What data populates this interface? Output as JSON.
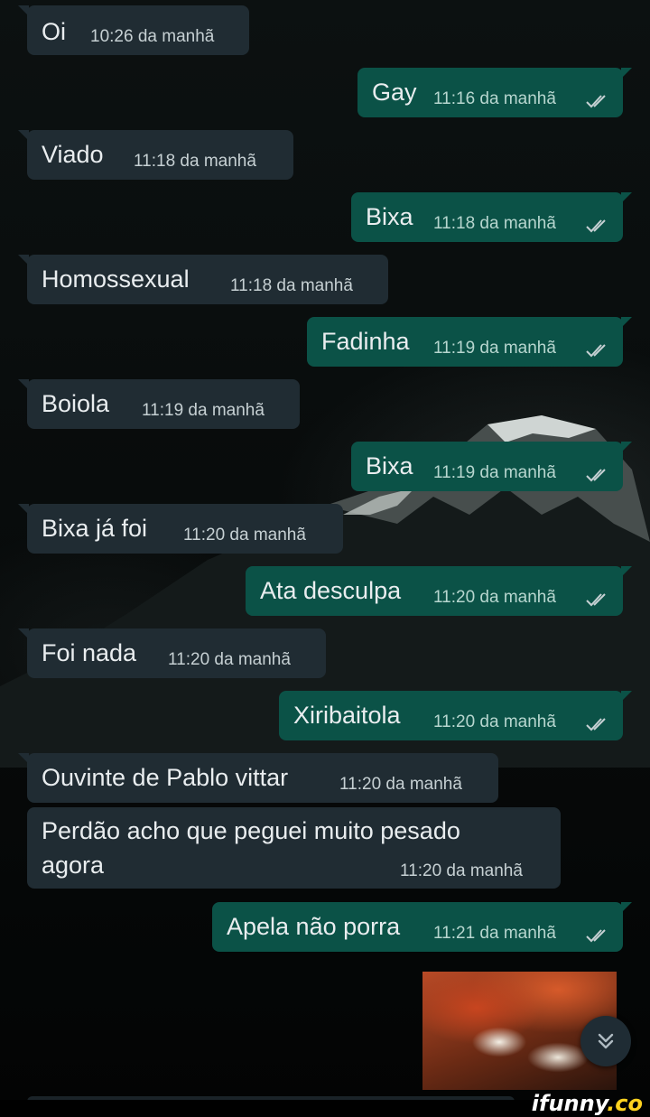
{
  "messages": [
    {
      "dir": "in",
      "text": "Oi",
      "time": "10:26 da manhã"
    },
    {
      "dir": "out",
      "text": "Gay",
      "time": "11:16 da manhã"
    },
    {
      "dir": "in",
      "text": "Viado",
      "time": "11:18 da manhã"
    },
    {
      "dir": "out",
      "text": "Bixa",
      "time": "11:18 da manhã"
    },
    {
      "dir": "in",
      "text": "Homossexual",
      "time": "11:18 da manhã"
    },
    {
      "dir": "out",
      "text": "Fadinha",
      "time": "11:19 da manhã"
    },
    {
      "dir": "in",
      "text": "Boiola",
      "time": "11:19 da manhã"
    },
    {
      "dir": "out",
      "text": "Bixa",
      "time": "11:19 da manhã"
    },
    {
      "dir": "in",
      "text": "Bixa já foi",
      "time": "11:20 da manhã"
    },
    {
      "dir": "out",
      "text": "Ata desculpa",
      "time": "11:20 da manhã"
    },
    {
      "dir": "in",
      "text": "Foi nada",
      "time": "11:20 da manhã"
    },
    {
      "dir": "out",
      "text": "Xiribaitola",
      "time": "11:20 da manhã"
    },
    {
      "dir": "in",
      "text": "Ouvinte de Pablo vittar",
      "time": "11:20 da manhã"
    },
    {
      "dir": "in",
      "text_line1": "Perdão acho que peguei muito pesado",
      "text_line2": "agora",
      "time": "11:20 da manhã"
    },
    {
      "dir": "out",
      "text": "Apela não porra",
      "time": "11:21 da manhã"
    }
  ],
  "image_message": {
    "icon": "image-thumbnail"
  },
  "scroll_button": {
    "icon": "double-chevron-down-icon"
  },
  "watermark": {
    "brand": "ifunny",
    "suffix": ".co"
  },
  "colors": {
    "incoming": "#202c33",
    "outgoing": "#0b5247",
    "text": "#e9edef",
    "ticks": "#c6d0d3"
  }
}
